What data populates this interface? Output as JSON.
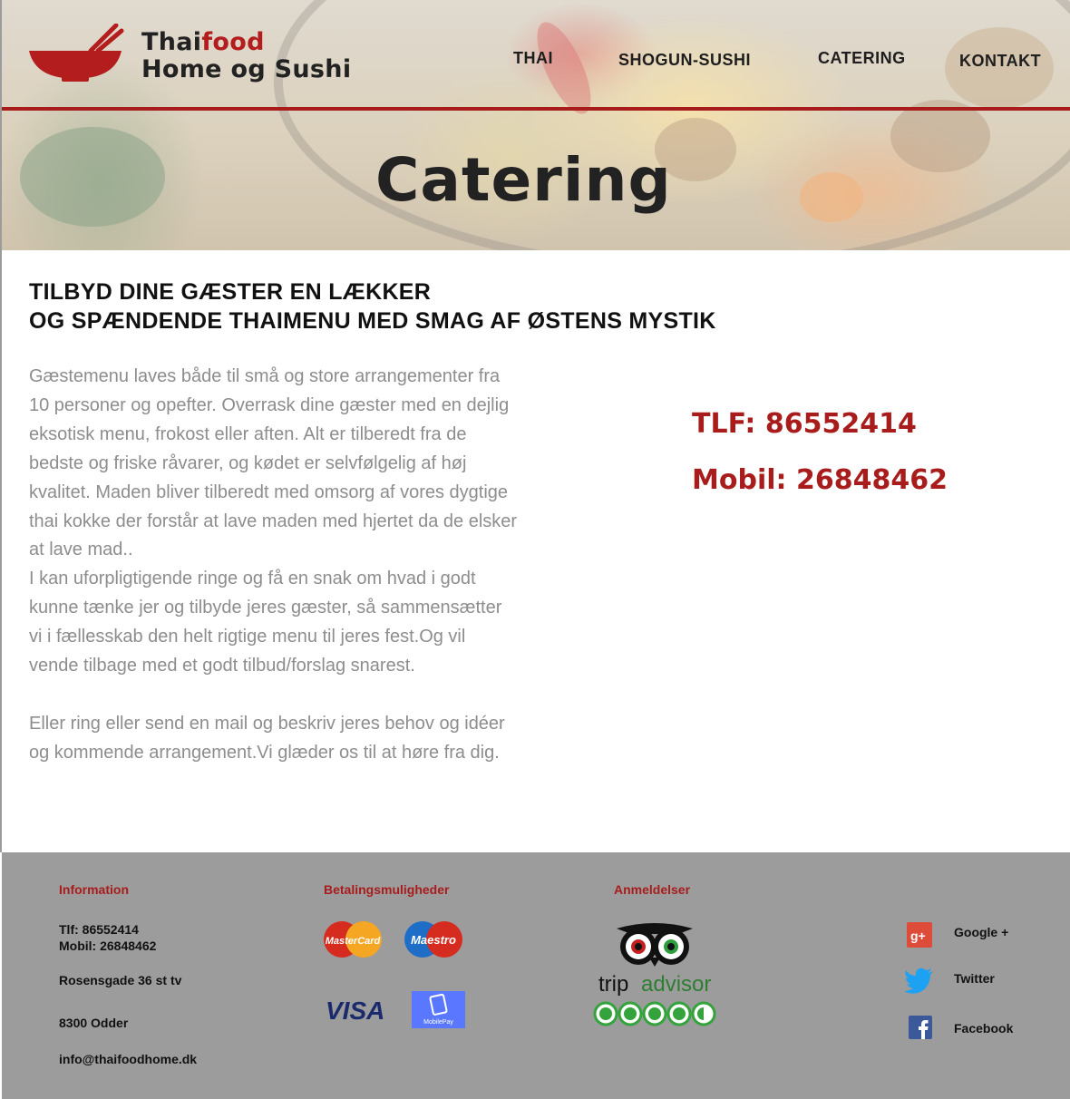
{
  "header": {
    "logo": {
      "line1_prefix": "Thai",
      "line1_accent": "food",
      "line2": "Home og Sushi"
    },
    "nav": [
      "THAI",
      "SHOGUN-SUSHI",
      "CATERING",
      "KONTAKT"
    ],
    "hero_title": "Catering"
  },
  "main": {
    "headline_line1": "TILBYD DINE GÆSTER EN LÆKKER",
    "headline_line2": "OG SPÆNDENDE THAIMENU MED SMAG AF ØSTENS MYSTIK",
    "paragraph1": "Gæstemenu laves både til små og store arrangementer fra 10 personer og opefter. Overrask dine gæster med en dejlig eksotisk menu, frokost eller aften. Alt er tilberedt fra de bedste og friske råvarer, og kødet er selvfølgelig af høj kvalitet. Maden bliver tilberedt med omsorg af vores dygtige thai kokke der forstår at lave maden med hjertet da de elsker at lave mad..",
    "paragraph2": "I kan uforpligtigende ringe og få en snak om hvad i godt kunne tænke jer og tilbyde jeres gæster, så sammensætter vi i fællesskab den helt rigtige menu til jeres fest.Og vil vende tilbage med et godt tilbud/forslag snarest.",
    "paragraph3": "Eller ring eller send en mail og beskriv jeres behov og idéer og kommende arrangement.Vi glæder os til at høre fra dig.",
    "tlf": "TLF: 86552414",
    "mobil": "Mobil: 26848462"
  },
  "footer": {
    "information": {
      "heading": "Information",
      "tlf": "Tlf: 86552414",
      "mobil": "Mobil: 26848462",
      "address": "Rosensgade 36 st tv",
      "city": "8300 Odder",
      "email": "info@thaifoodhome.dk"
    },
    "payment": {
      "heading": "Betalingsmuligheder",
      "mastercard": "MasterCard",
      "maestro": "Maestro",
      "visa": "VISA",
      "mobilepay": "MobilePay"
    },
    "reviews": {
      "heading": "Anmeldelser",
      "trip": "trip",
      "advisor": "advisor",
      "rating": 4.5
    },
    "social": [
      "Google +",
      "Twitter",
      "Facebook"
    ]
  },
  "colors": {
    "brand_red": "#a81c1c",
    "footer_bg": "#9c9c9c",
    "body_text": "#8d8d8d"
  }
}
